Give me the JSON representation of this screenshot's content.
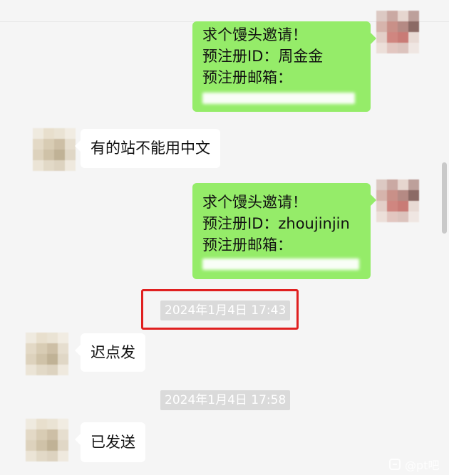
{
  "messages": {
    "m1": {
      "lines": [
        "求个馒头邀请！",
        "预注册ID：周金金",
        "预注册邮箱："
      ]
    },
    "m2": {
      "text": "有的站不能用中文"
    },
    "m3": {
      "lines": [
        "求个馒头邀请！",
        "预注册ID：zhoujinjin",
        "预注册邮箱："
      ]
    },
    "ts1": "2024年1月4日 17:43",
    "m4": {
      "text": "迟点发"
    },
    "ts2": "2024年1月4日 17:58",
    "m5": {
      "text": "已发送"
    }
  },
  "watermark": {
    "text": "@pt吧"
  },
  "colors": {
    "sent_bubble": "#95ec69",
    "received_bubble": "#ffffff",
    "highlight": "#e02020",
    "background": "#f5f5f5"
  }
}
